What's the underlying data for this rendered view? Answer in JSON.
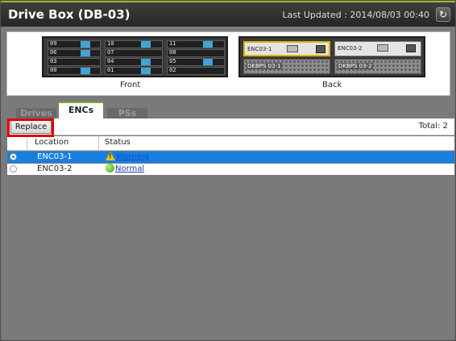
{
  "window": {
    "title": "Drive Box (DB-03)",
    "last_updated": "Last Updated : 2014/08/03 00:40",
    "refresh_icon": "refresh-icon"
  },
  "hardware": {
    "front_label": "Front",
    "back_label": "Back",
    "front_slots": [
      "09",
      "10",
      "11",
      "06",
      "07",
      "08",
      "03",
      "04",
      "05",
      "00",
      "01",
      "02"
    ],
    "back_enc": [
      "ENC03-1",
      "ENC03-2"
    ],
    "back_ps": [
      "DKBPS 03-1",
      "DKBPS 03-2"
    ]
  },
  "tabs": [
    {
      "label": "Drives",
      "active": false
    },
    {
      "label": "ENCs",
      "active": true
    },
    {
      "label": "PSs",
      "active": false
    }
  ],
  "toolbar": {
    "replace_label": "Replace",
    "total": "Total: 2"
  },
  "table": {
    "columns": [
      "Location",
      "Status"
    ],
    "rows": [
      {
        "location": "ENC03-1",
        "status": "Warning",
        "status_icon": "warning-icon",
        "selected": true
      },
      {
        "location": "ENC03-2",
        "status": "Normal",
        "status_icon": "normal-status-icon",
        "selected": false
      }
    ]
  },
  "colors": {
    "accent": "#7cab2a",
    "selection": "#1680e2",
    "highlight": "#e00000"
  }
}
